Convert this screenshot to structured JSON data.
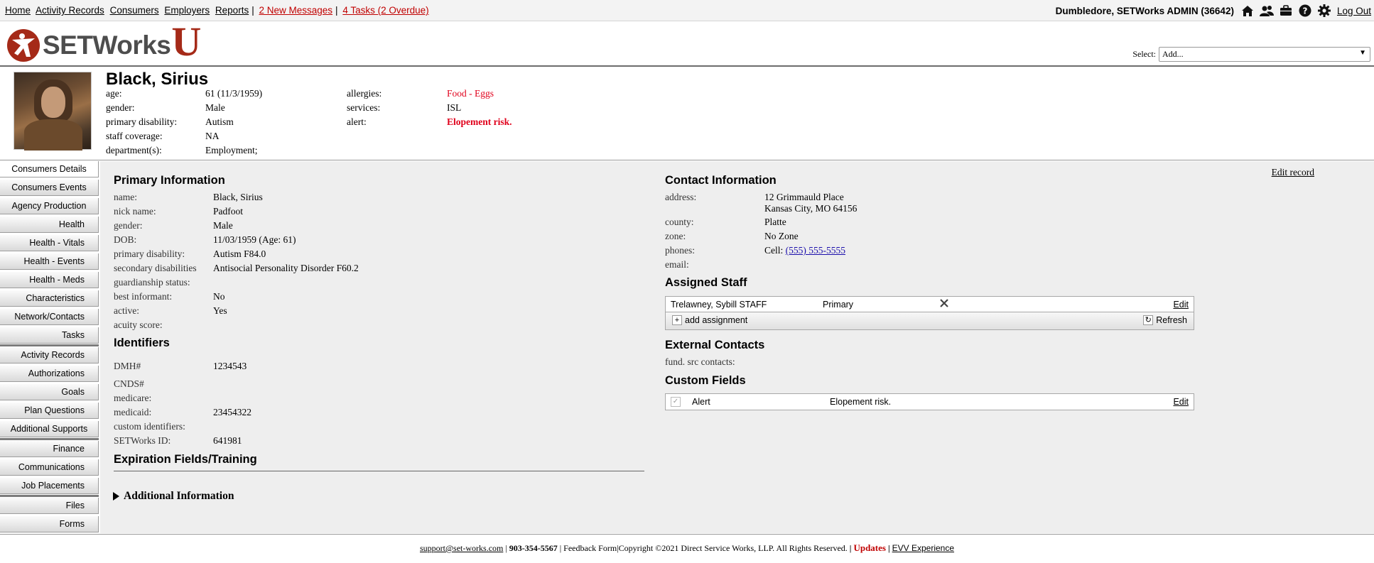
{
  "topnav": {
    "links": [
      "Home",
      "Activity Records",
      "Consumers",
      "Employers",
      "Reports"
    ],
    "messages": "2 New Messages",
    "tasks": "4 Tasks (2 Overdue)",
    "user": "Dumbledore, SETWorks ADMIN  (36642)",
    "logout": "Log Out",
    "icons": [
      "home-icon",
      "users-icon",
      "briefcase-icon",
      "help-icon",
      "gear-icon"
    ]
  },
  "logo": {
    "text": "SETWorks",
    "u": "U"
  },
  "select": {
    "label": "Select:",
    "value": "Add..."
  },
  "consumer": {
    "name": "Black, Sirius",
    "left": [
      {
        "label": "age:",
        "value": "61 (11/3/1959)"
      },
      {
        "label": "gender:",
        "value": "Male"
      },
      {
        "label": "primary disability:",
        "value": "Autism"
      },
      {
        "label": "staff coverage:",
        "value": "NA"
      },
      {
        "label": "department(s):",
        "value": "Employment;"
      }
    ],
    "right": [
      {
        "label": "allergies:",
        "value": "Food - Eggs"
      },
      {
        "label": "services:",
        "value": "ISL"
      },
      {
        "label": "alert:",
        "value": "Elopement risk."
      }
    ]
  },
  "sidebar": {
    "items": [
      "Consumers Details",
      "Consumers Events",
      "Agency Production",
      "Health",
      "Health - Vitals",
      "Health - Events",
      "Health - Meds",
      "Characteristics",
      "Network/Contacts",
      "Tasks",
      "Activity Records",
      "Authorizations",
      "Goals",
      "Plan Questions",
      "Additional Supports",
      "Finance",
      "Communications",
      "Job Placements",
      "Files",
      "Forms"
    ]
  },
  "main": {
    "edit_record": "Edit record",
    "primary": {
      "title": "Primary Information",
      "fields": [
        {
          "label": "name:",
          "value": "Black, Sirius"
        },
        {
          "label": "nick name:",
          "value": "Padfoot"
        },
        {
          "label": "gender:",
          "value": "Male"
        },
        {
          "label": "DOB:",
          "value": "11/03/1959 (Age: 61)"
        },
        {
          "label": "primary disability:",
          "value": "Autism F84.0"
        },
        {
          "label": "secondary disabilities",
          "value": "Antisocial Personality Disorder F60.2"
        },
        {
          "label": "guardianship status:",
          "value": ""
        },
        {
          "label": "best informant:",
          "value": "No"
        },
        {
          "label": "active:",
          "value": "Yes"
        },
        {
          "label": "acuity score:",
          "value": ""
        }
      ]
    },
    "identifiers": {
      "title": "Identifiers",
      "fields": [
        {
          "label": "DMH#",
          "value": "1234543"
        },
        {
          "label": "CNDS#",
          "value": ""
        },
        {
          "label": "medicare:",
          "value": ""
        },
        {
          "label": "medicaid:",
          "value": "23454322"
        },
        {
          "label": "custom identifiers:",
          "value": ""
        },
        {
          "label": "SETWorks ID:",
          "value": "641981"
        }
      ]
    },
    "expiration_title": "Expiration Fields/Training",
    "additional_title": "Additional Information",
    "contact": {
      "title": "Contact Information",
      "address_label": "address:",
      "address_line1": "12 Grimmauld Place",
      "address_line2": "Kansas City, MO 64156",
      "fields": [
        {
          "label": "county:",
          "value": "Platte"
        },
        {
          "label": "zone:",
          "value": "No Zone"
        }
      ],
      "phones_label": "phones:",
      "phone_prefix": "Cell:",
      "phone": "(555) 555-5555",
      "email_label": "email:"
    },
    "assigned_staff": {
      "title": "Assigned Staff",
      "staff": "Trelawney, Sybill STAFF",
      "role": "Primary",
      "edit": "Edit",
      "add": "add assignment",
      "refresh": "Refresh"
    },
    "external": {
      "title": "External Contacts",
      "label": "fund. src contacts:"
    },
    "custom_fields": {
      "title": "Custom Fields",
      "name": "Alert",
      "value": "Elopement risk.",
      "edit": "Edit"
    }
  },
  "footer": {
    "email": "support@set-works.com",
    "phone": "903-354-5567",
    "feedback": "Feedback Form",
    "copyright": "Copyright ©2021 Direct Service Works, LLP. All Rights Reserved.",
    "updates": "Updates",
    "evv": "EVV Experience"
  }
}
